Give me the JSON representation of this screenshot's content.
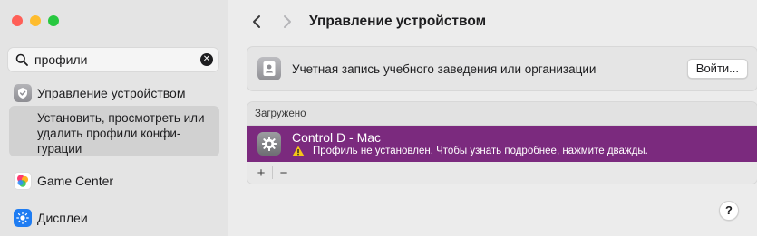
{
  "sidebar": {
    "search": {
      "value": "профили"
    },
    "items": [
      {
        "label": "Управление устройством",
        "icon": "device-management-icon"
      },
      {
        "label": "Game Center",
        "icon": "game-center-icon"
      },
      {
        "label": "Дисплеи",
        "icon": "displays-icon"
      }
    ],
    "result_text": "Установить, просмотреть или удалить профили конфи-гурации"
  },
  "main": {
    "title": "Управление устройством",
    "account_card": {
      "text": "Учетная запись учебного заведения или организации",
      "button": "Войти..."
    },
    "loaded": {
      "header": "Загружено",
      "profile": {
        "name": "Control D - Mac",
        "warning": "Профиль не установлен. Чтобы узнать подробнее, нажмите дважды."
      },
      "add_label": "+",
      "remove_label": "−"
    },
    "help_label": "?"
  },
  "colors": {
    "selected_row": "#7b2a7e",
    "traffic_red": "#ff5f57",
    "traffic_yellow": "#febc2e",
    "traffic_green": "#28c840",
    "warning": "#f5c518"
  }
}
